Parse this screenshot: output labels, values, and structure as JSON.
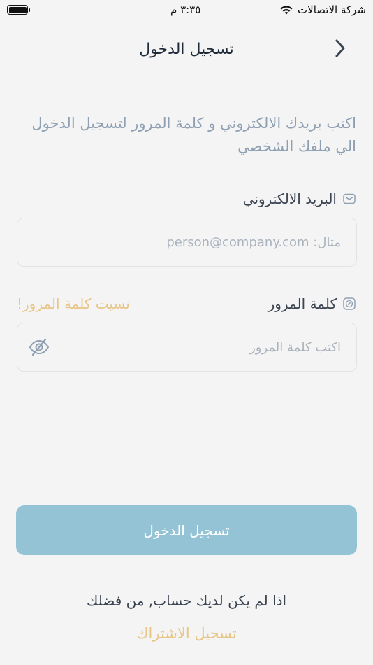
{
  "status_bar": {
    "carrier": "شركة الاتصالات",
    "time": "٣:٣٥ م"
  },
  "nav": {
    "title": "تسجيل الدخول"
  },
  "intro": {
    "text": "اكتب بريدك الالكتروني و كلمة المرور لتسجيل الدخول الي ملفك الشخصي"
  },
  "email": {
    "label": "البريد الالكتروني",
    "placeholder": "مثال: person@company.com",
    "value": ""
  },
  "password": {
    "label": "كلمة المرور",
    "placeholder": "اكتب كلمة المرور",
    "value": "",
    "forgot_label": "نسيت كلمة المرور!"
  },
  "actions": {
    "login_label": "تسجيل الدخول",
    "no_account_text": "اذا لم يكن لديك حساب, من فضلك",
    "signup_label": "تسجيل الاشتراك"
  },
  "colors": {
    "accent_gold": "#e7c688",
    "primary_button": "#93c3d5",
    "muted_text": "#8fa0b3",
    "background": "#f4f4f4"
  },
  "icons": {
    "back": "chevron-right-icon",
    "email": "envelope-icon",
    "password": "compass-icon",
    "visibility": "eye-off-icon"
  }
}
